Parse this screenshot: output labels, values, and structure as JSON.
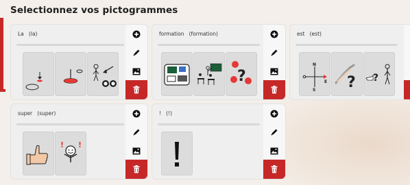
{
  "page": {
    "title": "Selectionnez vos pictogrammes"
  },
  "colors": {
    "accent": "#c62828",
    "card_bg": "#efefef",
    "tile_bg": "#dcdcdc"
  },
  "icons": {
    "add": "plus-circle-icon",
    "edit": "pencil-icon",
    "image": "image-icon",
    "delete": "trash-icon"
  },
  "cards": [
    {
      "word": "La",
      "lemma": "(la)",
      "pictograms": [
        "pictogram-la-1",
        "pictogram-la-2",
        "pictogram-la-3"
      ]
    },
    {
      "word": "formation",
      "lemma": "(formation)",
      "pictograms": [
        "pictogram-formation-1",
        "pictogram-formation-2",
        "pictogram-formation-3"
      ]
    },
    {
      "word": "est",
      "lemma": "(est)",
      "pictograms": [
        "pictogram-est-1",
        "pictogram-est-2",
        "pictogram-est-3"
      ]
    },
    {
      "word": "super",
      "lemma": "(super)",
      "pictograms": [
        "pictogram-super-1",
        "pictogram-super-2"
      ]
    },
    {
      "word": "!",
      "lemma": "(!)",
      "pictograms": [
        "pictogram-exclamation-1"
      ]
    }
  ]
}
